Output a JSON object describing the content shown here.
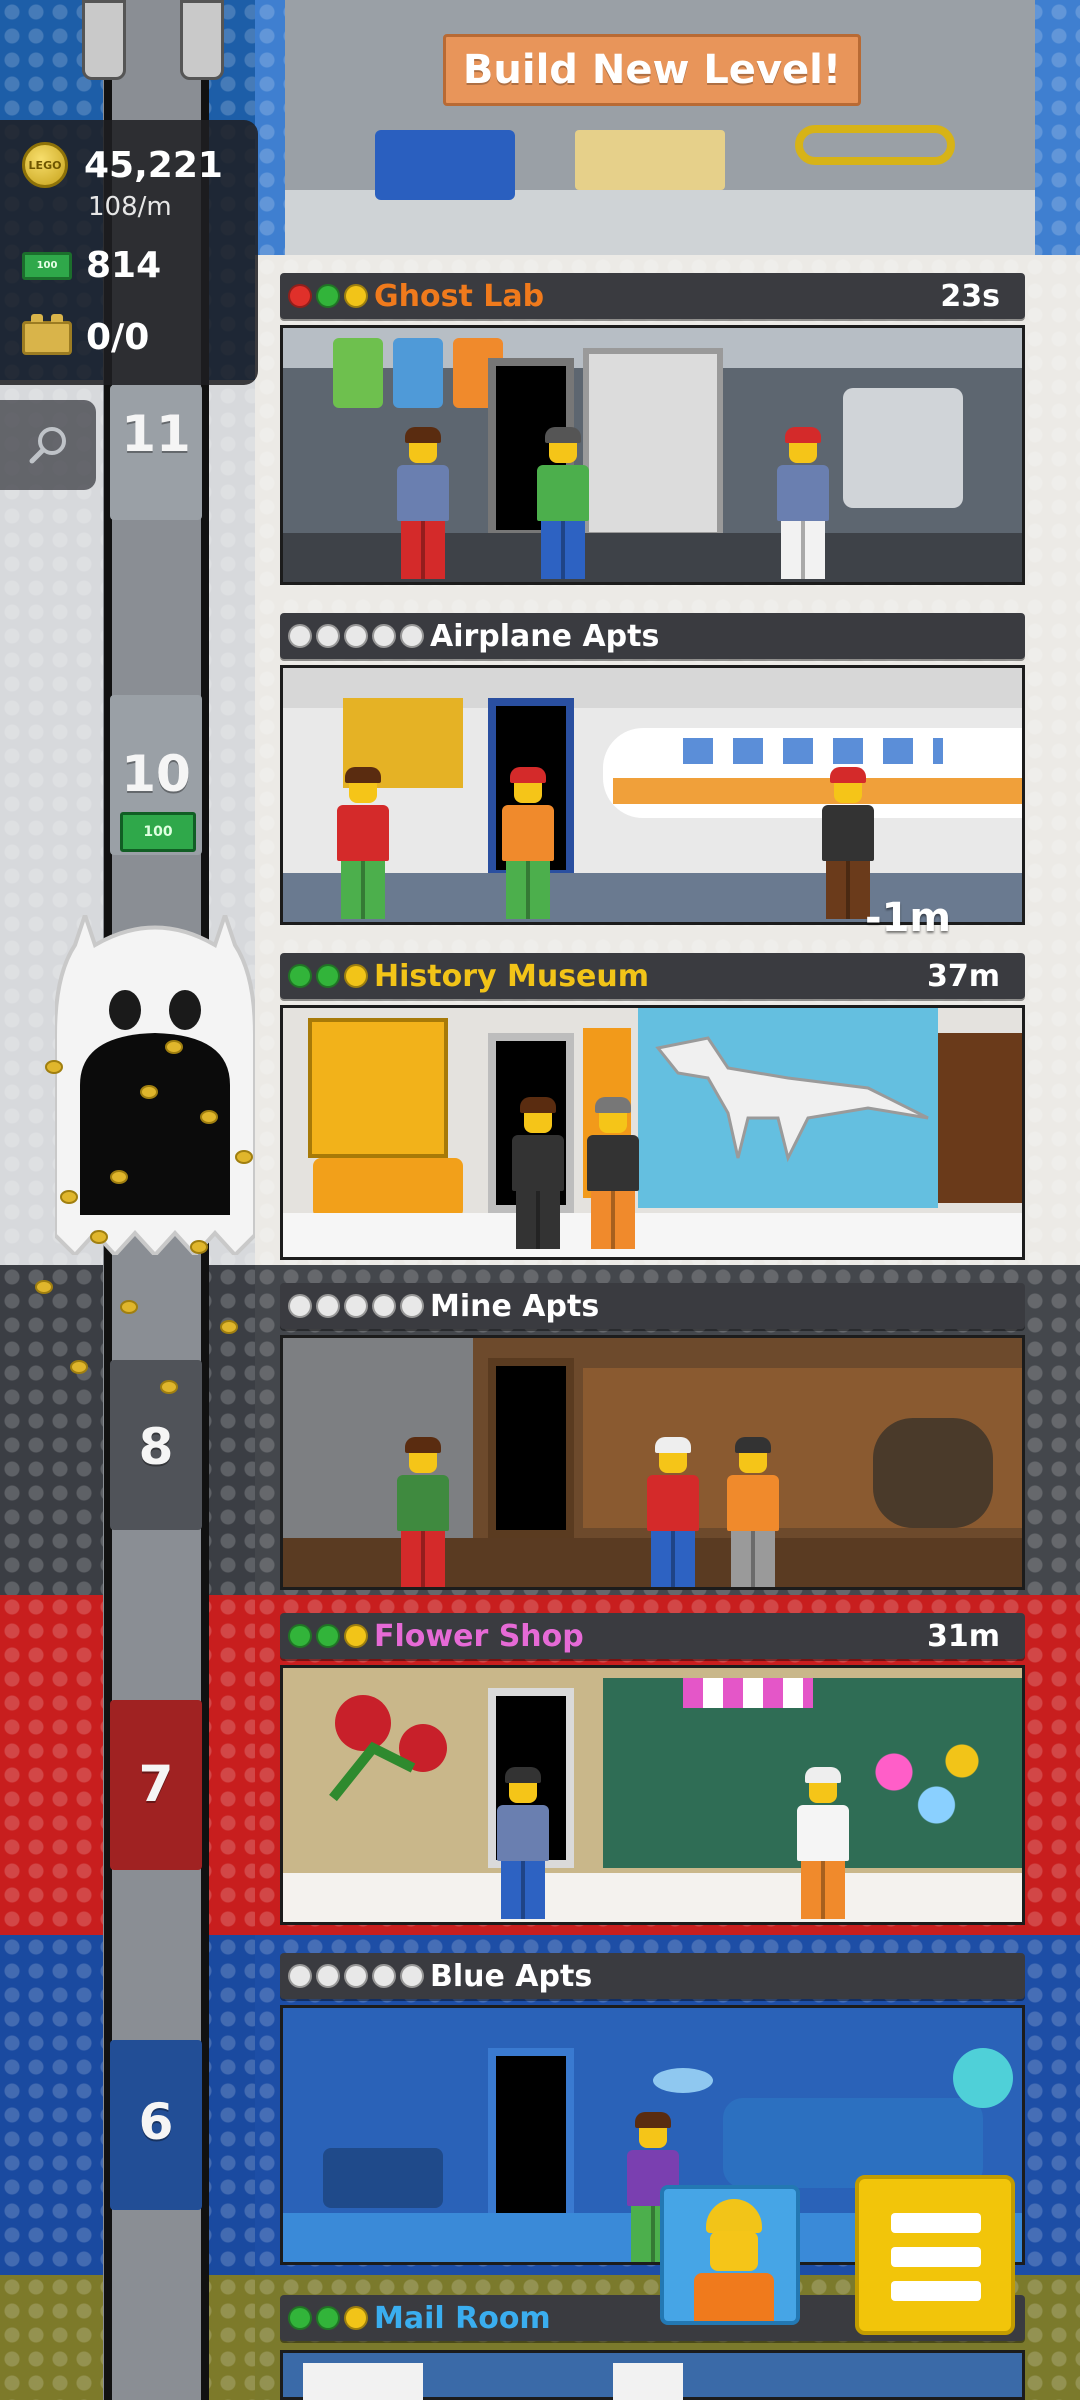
{
  "hud": {
    "coins": "45,221",
    "coins_rate": "108/m",
    "bux": "814",
    "crates": "0/0",
    "coin_icon_label": "LEGO",
    "bux_icon_label": "100"
  },
  "build_button": {
    "label": "Build New Level!"
  },
  "elevator": {
    "floor_numbers": [
      "11",
      "10",
      "8",
      "7",
      "6"
    ],
    "cash_note_label": "100",
    "ghost_icon": "ghost-elevator-icon"
  },
  "floors": [
    {
      "name": "Ghost Lab",
      "timer": "23s",
      "name_color": "#f07a1c",
      "stars": [
        "red",
        "green",
        "yellow"
      ],
      "type": "shop"
    },
    {
      "name": "Airplane Apts",
      "timer": "",
      "name_color": "#ffffff",
      "stars": [
        "empty",
        "empty",
        "empty",
        "empty",
        "empty"
      ],
      "type": "residential",
      "floating_text": "-1m"
    },
    {
      "name": "History Museum",
      "timer": "37m",
      "name_color": "#f2c418",
      "stars": [
        "green",
        "green",
        "yellow"
      ],
      "type": "shop"
    },
    {
      "name": "Mine Apts",
      "timer": "",
      "name_color": "#ffffff",
      "stars": [
        "empty",
        "empty",
        "empty",
        "empty",
        "empty"
      ],
      "type": "residential"
    },
    {
      "name": "Flower Shop",
      "timer": "31m",
      "name_color": "#e66ad6",
      "stars": [
        "green",
        "green",
        "yellow"
      ],
      "type": "shop"
    },
    {
      "name": "Blue Apts",
      "timer": "",
      "name_color": "#ffffff",
      "stars": [
        "empty",
        "empty",
        "empty",
        "empty",
        "empty"
      ],
      "type": "residential"
    },
    {
      "name": "Mail Room",
      "timer": "",
      "name_color": "#3aaef0",
      "stars": [
        "green",
        "green",
        "yellow"
      ],
      "type": "shop"
    }
  ],
  "buttons": {
    "search_icon": "search-icon",
    "menu_icon": "menu-icon",
    "worker_icon": "construction-worker-icon"
  },
  "colors": {
    "star_red": "#e0302a",
    "star_green": "#32b43a",
    "star_yellow": "#f2c418",
    "star_empty": "#e8e8e8"
  }
}
